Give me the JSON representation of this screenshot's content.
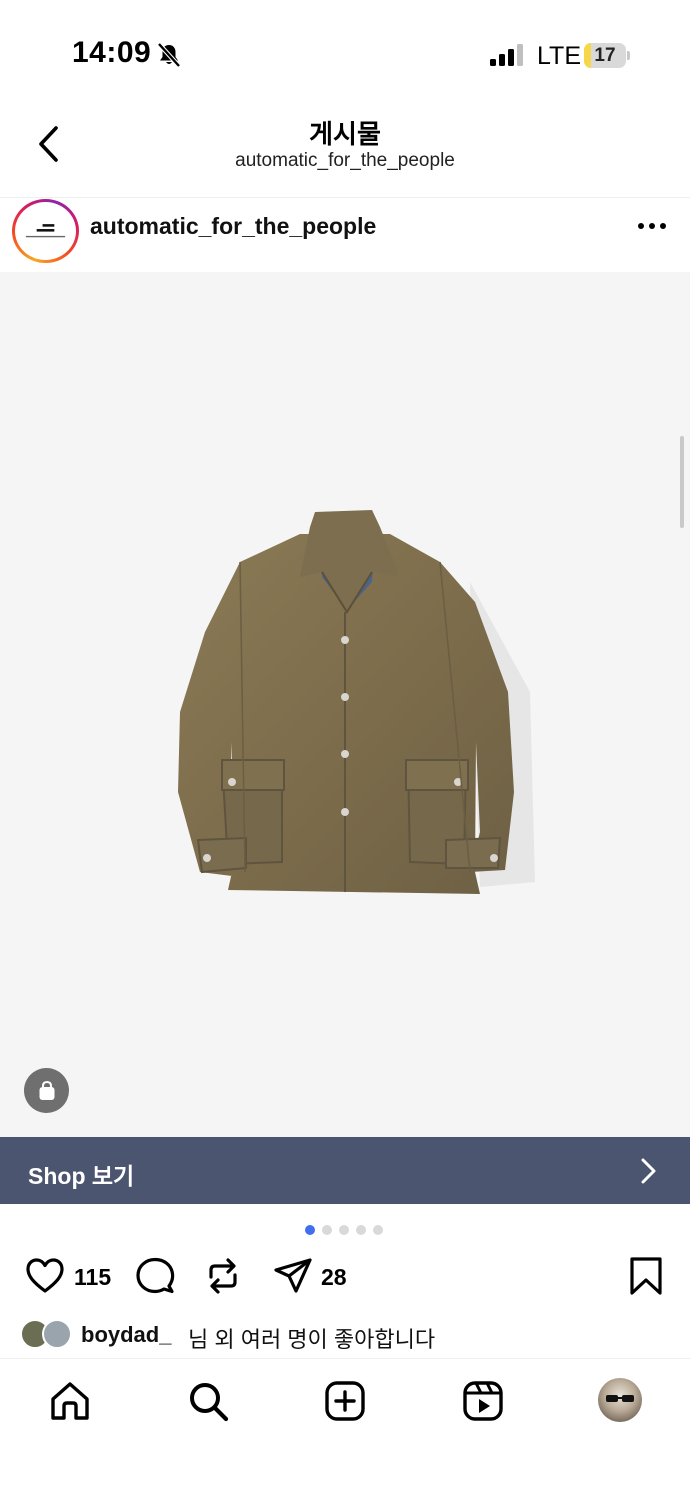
{
  "status_bar": {
    "time": "14:09",
    "network": "LTE",
    "battery_level": "17",
    "battery_fraction": 0.17,
    "icons": [
      "bell-slash-icon",
      "signal-icon",
      "battery-icon"
    ]
  },
  "header": {
    "title": "게시물",
    "subtitle": "automatic_for_the_people",
    "back_icon": "chevron-left-icon"
  },
  "post": {
    "username": "automatic_for_the_people",
    "more_icon": "ellipsis-icon",
    "media": {
      "carousel_total": 5,
      "carousel_active": 1,
      "shop_tag_icon": "shopping-bag-icon"
    },
    "shop_bar": {
      "label": "Shop 보기",
      "chevron_icon": "chevron-right-icon",
      "color": "#4b5570"
    },
    "actions": {
      "like_count": "115",
      "share_count": "28",
      "icons": [
        "heart-icon",
        "comment-icon",
        "repost-icon",
        "send-icon",
        "bookmark-icon"
      ]
    },
    "likes": {
      "user": "boydad_",
      "text": "님 외 여러 명이 좋아합니다"
    }
  },
  "tab_bar": {
    "items": [
      "home-icon",
      "search-icon",
      "create-icon",
      "reels-icon",
      "profile-avatar"
    ]
  },
  "colors": {
    "accent_dot": "#3f6ff0",
    "battery_fill": "#f7d74a"
  }
}
